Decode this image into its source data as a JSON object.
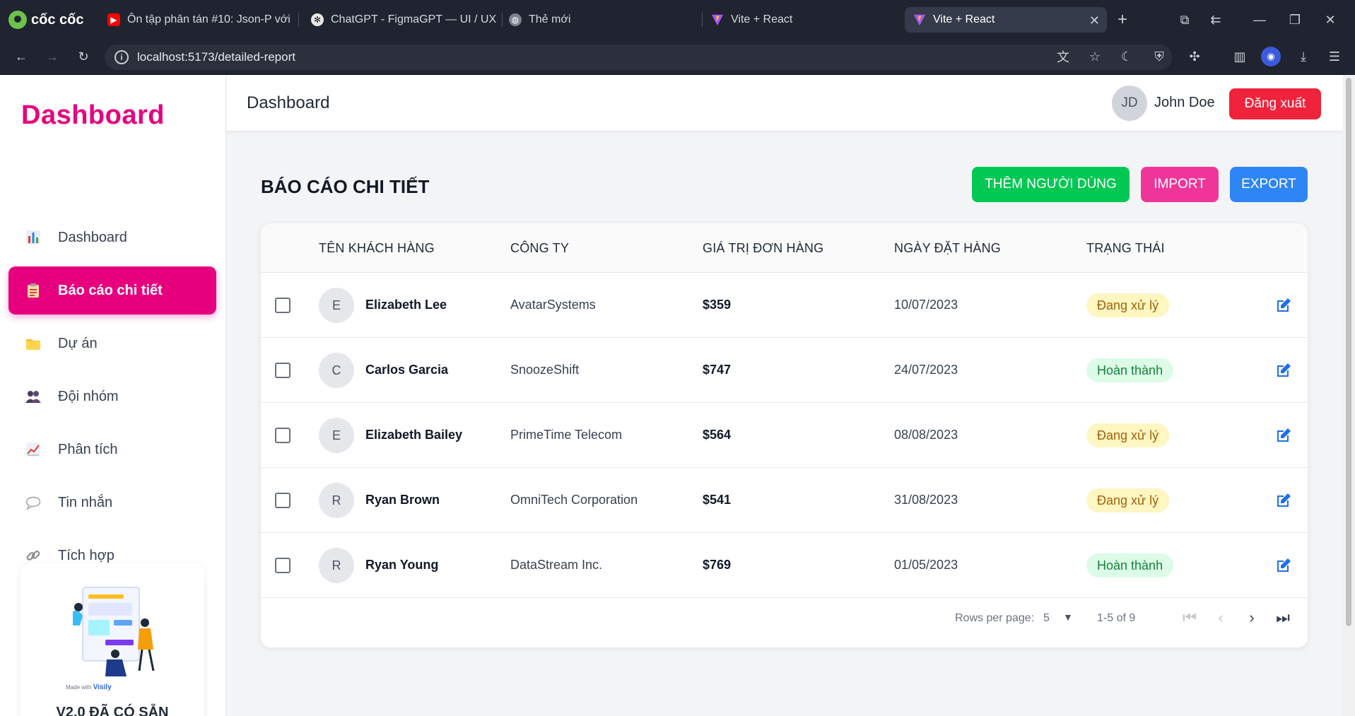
{
  "browser": {
    "logo_text": "cốc cốc",
    "tabs": [
      {
        "title": "Ôn tập phân tán #10: Json-P với",
        "icon": "youtube-icon"
      },
      {
        "title": "ChatGPT - FigmaGPT — UI / UX",
        "icon": "chatgpt-icon"
      },
      {
        "title": "Thẻ mới",
        "icon": "globe-icon"
      },
      {
        "title": "Vite + React",
        "icon": "vite-icon"
      },
      {
        "title": "Vite + React",
        "icon": "vite-icon",
        "active": true
      }
    ],
    "url": "localhost:5173/detailed-report"
  },
  "sidebar": {
    "brand": "Dashboard",
    "items": [
      {
        "label": "Dashboard",
        "icon": "bar-chart-icon"
      },
      {
        "label": "Báo cáo chi tiết",
        "icon": "clipboard-icon",
        "active": true
      },
      {
        "label": "Dự án",
        "icon": "folder-icon"
      },
      {
        "label": "Đội nhóm",
        "icon": "team-icon"
      },
      {
        "label": "Phân tích",
        "icon": "line-chart-icon"
      },
      {
        "label": "Tin nhắn",
        "icon": "chat-bubble-icon"
      },
      {
        "label": "Tích hợp",
        "icon": "link-icon"
      }
    ],
    "promo": {
      "made_with": "Made with",
      "brand": "Visily",
      "title": "V2.0 ĐÃ CÓ SẴN"
    }
  },
  "topbar": {
    "title": "Dashboard",
    "user_initials": "JD",
    "user_name": "John Doe",
    "logout_label": "Đăng xuất"
  },
  "main": {
    "title": "BÁO CÁO CHI TIẾT",
    "add_user_label": "THÊM NGƯỜI DÙNG",
    "import_label": "IMPORT",
    "export_label": "EXPORT"
  },
  "table": {
    "columns": [
      "TÊN KHÁCH HÀNG",
      "CÔNG TY",
      "GIÁ TRỊ ĐƠN HÀNG",
      "NGÀY ĐẶT HÀNG",
      "TRẠNG THÁI"
    ],
    "rows": [
      {
        "initial": "E",
        "name": "Elizabeth Lee",
        "company": "AvatarSystems",
        "value": "$359",
        "date": "10/07/2023",
        "status": "Đang xử lý",
        "status_type": "processing"
      },
      {
        "initial": "C",
        "name": "Carlos Garcia",
        "company": "SnoozeShift",
        "value": "$747",
        "date": "24/07/2023",
        "status": "Hoàn thành",
        "status_type": "done"
      },
      {
        "initial": "E",
        "name": "Elizabeth Bailey",
        "company": "PrimeTime Telecom",
        "value": "$564",
        "date": "08/08/2023",
        "status": "Đang xử lý",
        "status_type": "processing"
      },
      {
        "initial": "R",
        "name": "Ryan Brown",
        "company": "OmniTech Corporation",
        "value": "$541",
        "date": "31/08/2023",
        "status": "Đang xử lý",
        "status_type": "processing"
      },
      {
        "initial": "R",
        "name": "Ryan Young",
        "company": "DataStream Inc.",
        "value": "$769",
        "date": "01/05/2023",
        "status": "Hoàn thành",
        "status_type": "done"
      }
    ],
    "pagination": {
      "rows_per_page_label": "Rows per page:",
      "rows_per_page_value": "5",
      "range": "1-5 of 9"
    }
  },
  "colors": {
    "brand": "#e6007e",
    "add_button": "#00c853",
    "import_button": "#f0359a",
    "export_button": "#2e86f5",
    "logout_button": "#ef233c"
  }
}
